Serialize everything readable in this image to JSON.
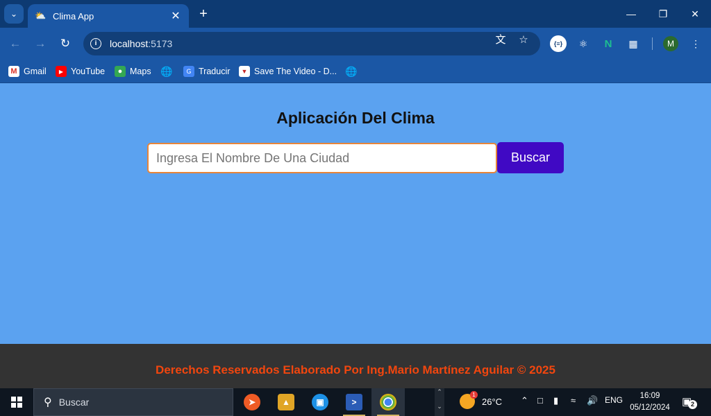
{
  "browser": {
    "tab": {
      "title": "Clima App"
    },
    "url": {
      "host": "localhost",
      "port": ":5173"
    },
    "bookmarks": [
      {
        "label": "Gmail"
      },
      {
        "label": "YouTube"
      },
      {
        "label": "Maps"
      },
      {
        "label": ""
      },
      {
        "label": "Traducir"
      },
      {
        "label": "Save The Video - D..."
      },
      {
        "label": ""
      }
    ],
    "profile_initial": "M"
  },
  "page": {
    "title": "Aplicación Del Clima",
    "search": {
      "placeholder": "Ingresa El Nombre De Una Ciudad",
      "value": "",
      "button_label": "Buscar"
    },
    "footer": "Derechos Reservados Elaborado Por Ing.Mario Martínez Aguilar © 2025"
  },
  "taskbar": {
    "search_label": "Buscar",
    "weather": {
      "temp": "26°C",
      "badge": "1"
    },
    "lang": "ENG",
    "time": "16:09",
    "date": "05/12/2024",
    "notifications": "2"
  },
  "colors": {
    "page_bg": "#5ba2f0",
    "button_bg": "#4009c4",
    "footer_bg": "#333333",
    "footer_text": "#f2460e",
    "input_border": "#e7853a"
  }
}
